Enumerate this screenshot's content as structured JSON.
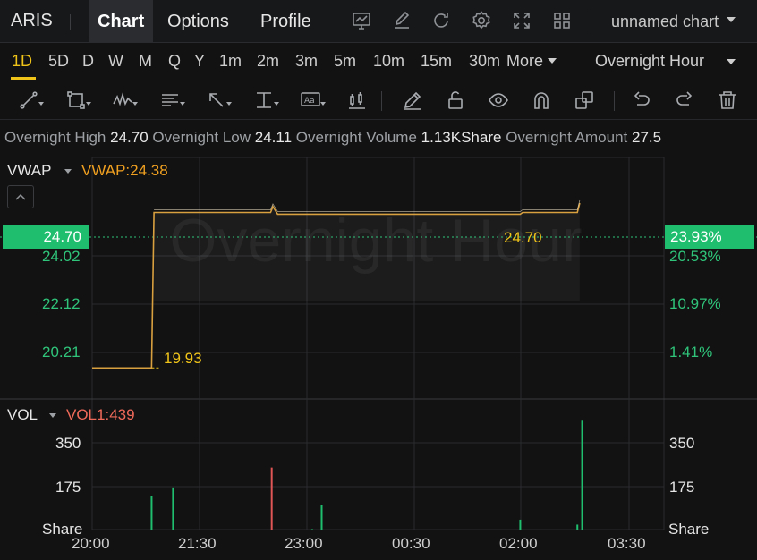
{
  "header": {
    "ticker": "ARIS",
    "tabs": [
      {
        "label": "Chart",
        "active": true
      },
      {
        "label": "Options",
        "active": false
      },
      {
        "label": "Profile",
        "active": false
      }
    ],
    "icons": [
      "chart-window-icon",
      "edit-icon",
      "refresh-icon",
      "settings-icon",
      "fullscreen-icon",
      "grid-layout-icon"
    ],
    "chart_name": "unnamed chart"
  },
  "timeframes": {
    "items": [
      "1D",
      "5D",
      "D",
      "W",
      "M",
      "Q",
      "Y",
      "1m",
      "2m",
      "3m",
      "5m",
      "10m",
      "15m",
      "30m"
    ],
    "active": "1D",
    "more_label": "More",
    "session_label": "Overnight Hour"
  },
  "tools": [
    "trend-line-icon",
    "rectangle-icon",
    "pattern-icon",
    "text-note-icon",
    "arrow-icon",
    "horizontal-line-icon",
    "text-box-icon",
    "candlestick-icon",
    "pencil-icon",
    "unlock-icon",
    "eye-icon",
    "magnet-icon",
    "layers-icon",
    "undo-icon",
    "redo-icon",
    "trash-icon"
  ],
  "info_bar": {
    "high_label": "Overnight High",
    "high_value": "24.70",
    "low_label": "Overnight Low",
    "low_value": "24.11",
    "volume_label": "Overnight Volume",
    "volume_value": "1.13KShare",
    "amount_label": "Overnight Amount",
    "amount_value": "27.5"
  },
  "price_panel": {
    "indicator": "VWAP",
    "indicator_value": "VWAP:24.38",
    "watermark": "Overnight Hour",
    "current_price": "24.70",
    "current_pct": "23.93%",
    "y_labels": [
      "24.02",
      "22.12",
      "20.21"
    ],
    "pct_labels": [
      "20.53%",
      "10.97%",
      "1.41%"
    ],
    "low_marker": "19.93",
    "high_marker": "24.70"
  },
  "volume_panel": {
    "indicator": "VOL",
    "indicator_value": "VOL1:439",
    "y_labels": [
      "350",
      "175"
    ],
    "unit": "Share"
  },
  "x_labels": [
    "20:00",
    "21:30",
    "23:00",
    "00:30",
    "02:00",
    "03:30"
  ],
  "colors": {
    "up": "#1fbe6e",
    "down": "#e05555",
    "price_line": "#d9a040",
    "vwap_label": "#f0a020",
    "vol_label": "#f06a5a",
    "accent": "#f0c419"
  },
  "chart_data": {
    "type": "line",
    "x_unit": "time",
    "y_range": [
      19.6,
      25.4
    ],
    "price_series": [
      {
        "t": "20:00",
        "y": 19.93
      },
      {
        "t": "20:50",
        "y": 19.93
      },
      {
        "t": "20:52",
        "y": 24.43
      },
      {
        "t": "22:30",
        "y": 24.43
      },
      {
        "t": "22:32",
        "y": 24.6
      },
      {
        "t": "22:36",
        "y": 24.38
      },
      {
        "t": "02:00",
        "y": 24.38
      },
      {
        "t": "02:02",
        "y": 24.43
      },
      {
        "t": "02:48",
        "y": 24.43
      },
      {
        "t": "02:50",
        "y": 24.7
      }
    ],
    "vwap": 24.38,
    "volume_range": [
      0,
      440
    ],
    "volumes": [
      {
        "t": "20:50",
        "v": 135,
        "dir": "up"
      },
      {
        "t": "21:08",
        "v": 170,
        "dir": "up"
      },
      {
        "t": "22:31",
        "v": 250,
        "dir": "down"
      },
      {
        "t": "23:05",
        "v": 2,
        "dir": "up"
      },
      {
        "t": "23:13",
        "v": 100,
        "dir": "up"
      },
      {
        "t": "02:00",
        "v": 40,
        "dir": "up"
      },
      {
        "t": "02:48",
        "v": 20,
        "dir": "up"
      },
      {
        "t": "02:52",
        "v": 439,
        "dir": "up"
      }
    ]
  }
}
